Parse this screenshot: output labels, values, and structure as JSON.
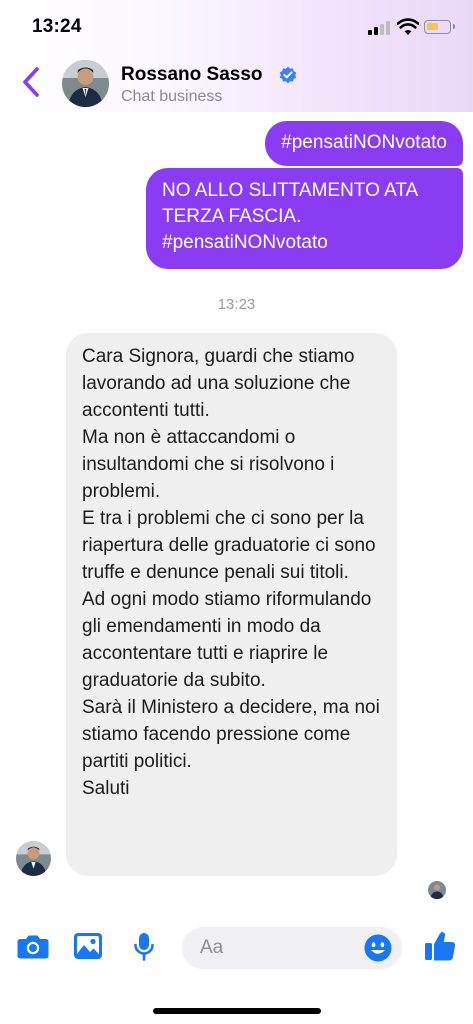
{
  "status_bar": {
    "time": "13:24",
    "signal_icon": "signal-bars-icon",
    "wifi_icon": "wifi-icon",
    "battery_icon": "battery-low-icon",
    "battery_color": "#f6c843"
  },
  "header": {
    "back_icon": "chevron-left-icon",
    "contact_name": "Rossano Sasso",
    "verified_icon": "verified-badge-icon",
    "subtitle": "Chat business"
  },
  "messages": [
    {
      "direction": "outgoing",
      "text": "#pensatiNONvotato"
    },
    {
      "direction": "outgoing",
      "text": "NO ALLO SLITTAMENTO ATA TERZA FASCIA. #pensatiNONvotato"
    }
  ],
  "timestamp": "13:23",
  "incoming_message": {
    "lines": [
      "Cara Signora, guardi che stiamo lavorando ad una soluzione che accontenti tutti.",
      "Ma non è attaccandomi o insultandomi che si risolvono i problemi.",
      "E tra i problemi che ci sono per la riapertura delle graduatorie ci sono truffe e denunce penali sui titoli.",
      "Ad ogni modo stiamo riformulando gli emendamenti in modo da accontentare tutti e riaprire le graduatorie da subito.",
      "Sarà il Ministero a decidere, ma noi stiamo facendo pressione come partiti politici.",
      "Saluti"
    ]
  },
  "composer": {
    "camera_icon": "camera-icon",
    "gallery_icon": "image-icon",
    "mic_icon": "microphone-icon",
    "placeholder": "Aa",
    "emoji_icon": "emoji-icon",
    "like_icon": "thumbs-up-icon"
  },
  "colors": {
    "accent": "#8a3cf3",
    "icon_blue": "#1877f2",
    "incoming_bubble": "#efeff0"
  }
}
